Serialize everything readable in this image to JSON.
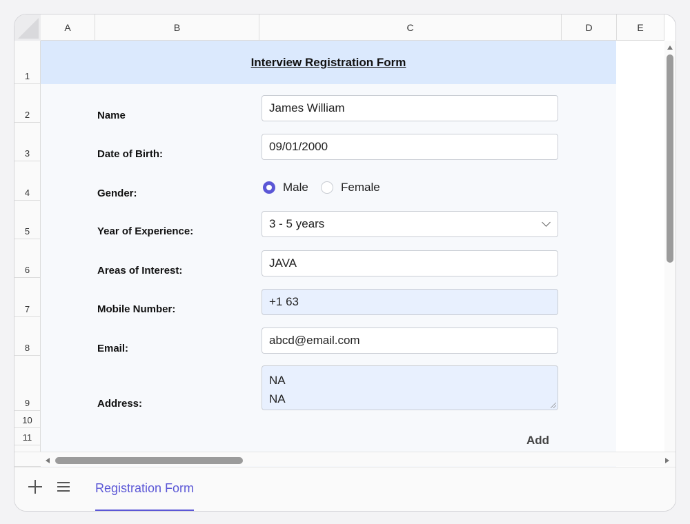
{
  "columns": [
    "A",
    "B",
    "C",
    "D",
    "E"
  ],
  "rows": [
    "1",
    "2",
    "3",
    "4",
    "5",
    "6",
    "7",
    "8",
    "9",
    "10",
    "11"
  ],
  "form": {
    "title": "Interview Registration Form",
    "name_label": "Name",
    "name_value": "James William",
    "dob_label": "Date of Birth:",
    "dob_value": "09/01/2000",
    "gender_label": "Gender:",
    "gender_options": [
      "Male",
      "Female"
    ],
    "gender_selected": "Male",
    "experience_label": "Year of Experience:",
    "experience_value": "3 - 5 years",
    "interest_label": "Areas of Interest:",
    "interest_value": "JAVA",
    "mobile_label": "Mobile Number:",
    "mobile_value": "+1 63",
    "email_label": "Email:",
    "email_value": "abcd@email.com",
    "address_label": "Address:",
    "address_lines": [
      "NA",
      "NA"
    ],
    "add_button": "Add"
  },
  "tabs": {
    "active": "Registration Form"
  },
  "colors": {
    "accent": "#5b57d6",
    "header_fill": "#dbe9fd",
    "shaded_field": "#e8f0fe"
  }
}
